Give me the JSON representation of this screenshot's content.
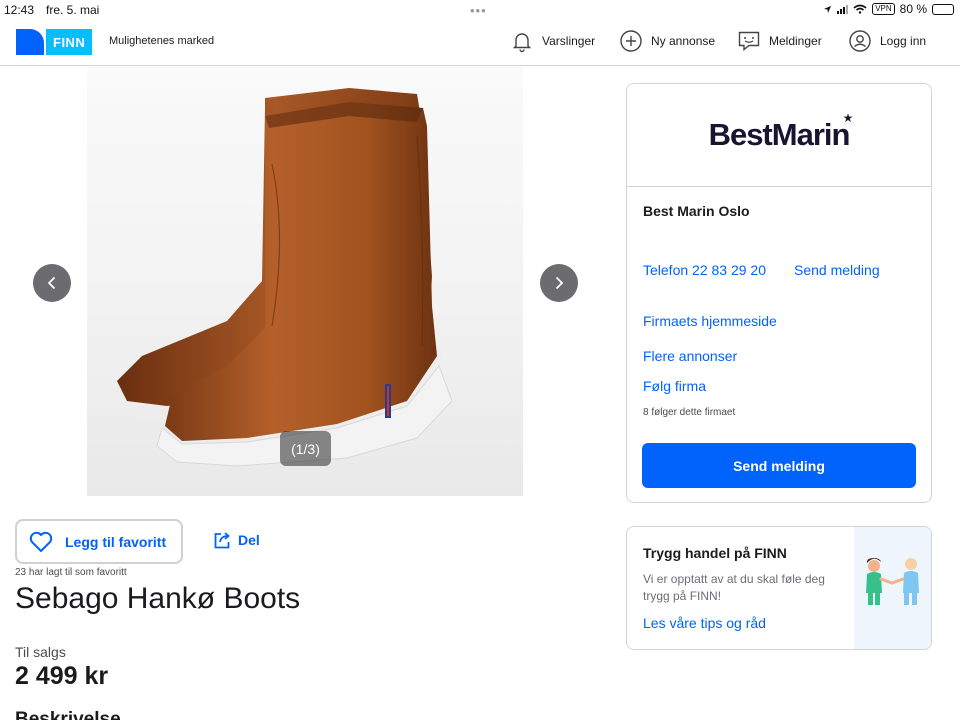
{
  "status_bar": {
    "time": "12:43",
    "date": "fre. 5. mai",
    "vpn": "VPN",
    "battery": "80 %",
    "battery_level": 0.8
  },
  "header": {
    "logo_text": "FINN",
    "tagline": "Mulighetenes marked",
    "nav": [
      {
        "label": "Varslinger",
        "icon": "bell-icon"
      },
      {
        "label": "Ny annonse",
        "icon": "plus-circle-icon"
      },
      {
        "label": "Meldinger",
        "icon": "chat-icon"
      },
      {
        "label": "Logg inn",
        "icon": "user-icon"
      }
    ]
  },
  "gallery": {
    "counter": "(1/3)",
    "current": 1,
    "total": 3
  },
  "listing": {
    "favorite_label": "Legg til favoritt",
    "share_label": "Del",
    "favorite_count": "23 har lagt til som favoritt",
    "title": "Sebago Hankø Boots",
    "sale_label": "Til salgs",
    "price": "2 499 kr",
    "description_heading": "Beskrivelse"
  },
  "seller": {
    "brand_logo": "BestMarin",
    "name": "Best Marin Oslo",
    "phone": "Telefon 22 83 29 20",
    "send_message_link": "Send melding",
    "homepage": "Firmaets hjemmeside",
    "more_ads": "Flere annonser",
    "follow": "Følg firma",
    "followers": "8 følger dette firmaet",
    "send_button": "Send melding"
  },
  "safe_trade": {
    "title": "Trygg handel på FINN",
    "body": "Vi er opptatt av at du skal føle deg trygg på FINN!",
    "link": "Les våre tips og råd"
  },
  "colors": {
    "primary": "#0063fb",
    "logo_light": "#06befb",
    "text": "#1b1b1f",
    "muted": "#6c6c74",
    "border": "#d4d4d8"
  }
}
